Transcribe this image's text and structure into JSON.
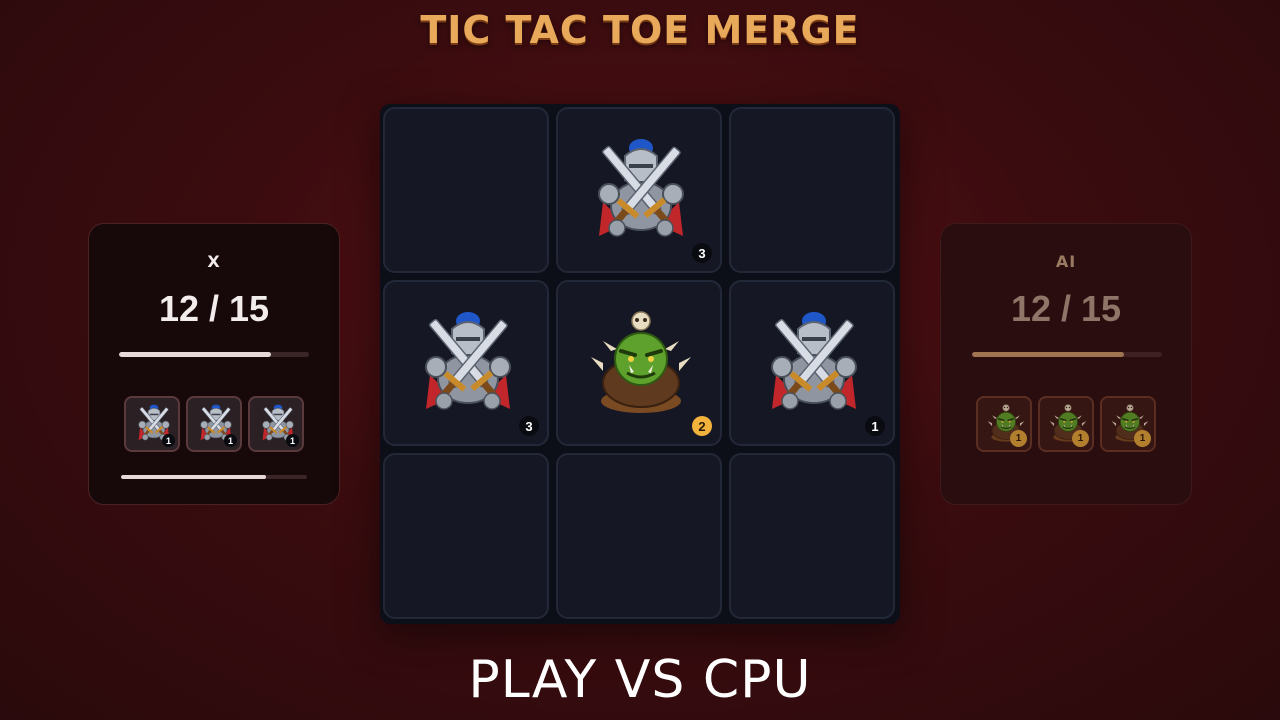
{
  "title": "TIC TAC TOE MERGE",
  "cta_label": "PLAY VS CPU",
  "colors": {
    "title": "#e9a95a",
    "background": "#3b0c0f",
    "board": "#0d0f18",
    "ai_badge": "#f2b33d"
  },
  "board": {
    "cells": [
      {
        "unit": "",
        "level": ""
      },
      {
        "unit": "knight",
        "level": "3"
      },
      {
        "unit": "",
        "level": ""
      },
      {
        "unit": "knight",
        "level": "3"
      },
      {
        "unit": "orc",
        "level": "2"
      },
      {
        "unit": "knight",
        "level": "1"
      },
      {
        "unit": "",
        "level": ""
      },
      {
        "unit": "",
        "level": ""
      },
      {
        "unit": "",
        "level": ""
      }
    ]
  },
  "player": {
    "name": "X",
    "score": "12 / 15",
    "progress": 0.8,
    "hand_progress": 0.78,
    "hand": [
      {
        "unit": "knight",
        "level": "1"
      },
      {
        "unit": "knight",
        "level": "1"
      },
      {
        "unit": "knight",
        "level": "1"
      }
    ]
  },
  "ai": {
    "name": "AI",
    "score": "12 / 15",
    "progress": 0.8,
    "hand": [
      {
        "unit": "orc",
        "level": "1"
      },
      {
        "unit": "orc",
        "level": "1"
      },
      {
        "unit": "orc",
        "level": "1"
      }
    ]
  }
}
